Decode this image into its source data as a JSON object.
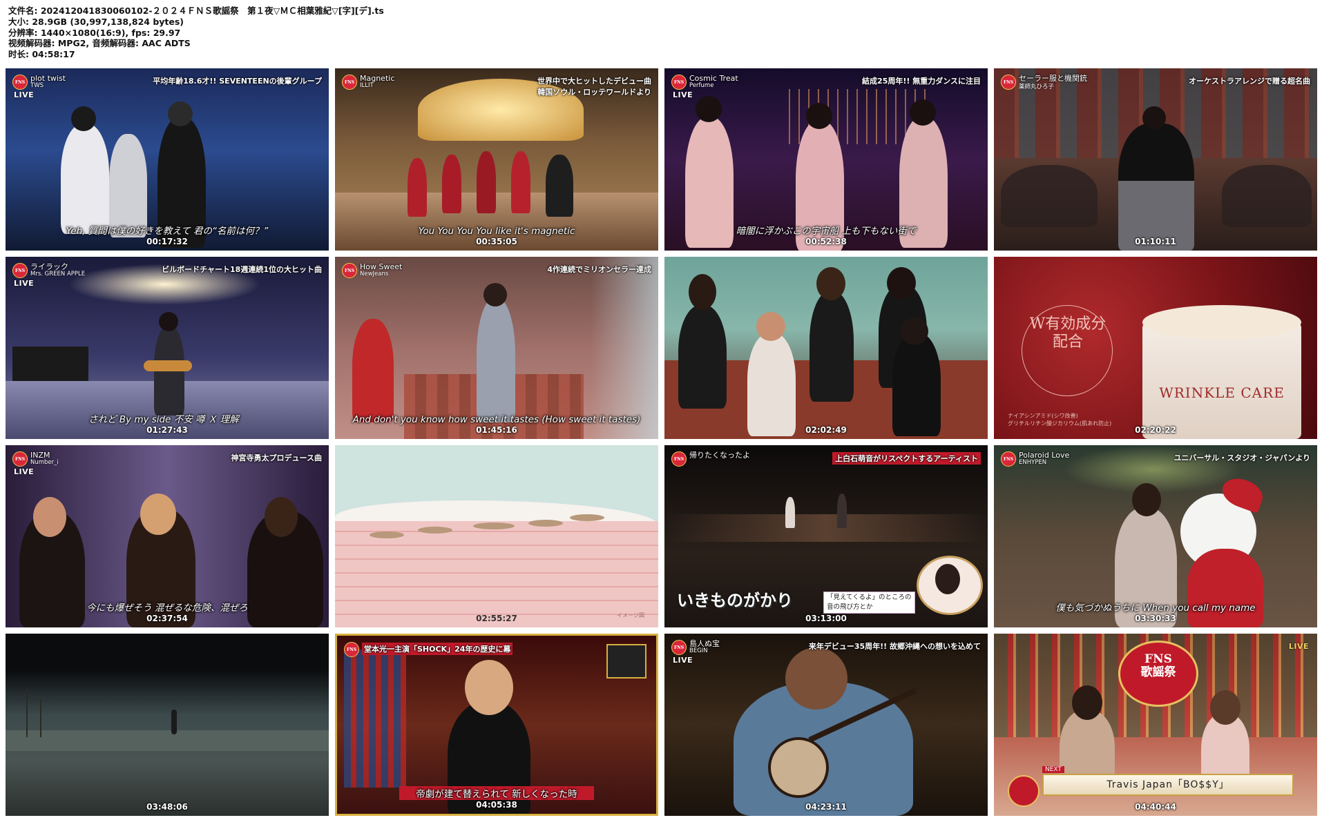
{
  "header": {
    "lines": [
      "文件名: 20241204183006010­2-２０２４ＦＮＳ歌謡祭　第１夜▽ＭＣ相葉雅紀▽[字][デ].ts",
      "大小: 28.9GB (30,997,138,824 bytes)",
      "分辨率: 1440×1080(16:9), fps: 29.97",
      "视频解码器: MPG2, 音频解码器: AAC ADTS",
      "时长: 04:58:17"
    ]
  },
  "tiles": [
    {
      "song": "plot twist",
      "artist": "TWS",
      "live": "LIVE",
      "caption": "平均年齢18.6才!! SEVENTEENの後輩グループ",
      "subtitle": "Yeh, 質問は僕の好きを教えて 君の“名前は何？”",
      "timestamp": "00:17:32",
      "bg": "#2a3f78"
    },
    {
      "song": "Magnetic",
      "artist": "ILLIT",
      "live": "",
      "caption": "世界中で大ヒットしたデビュー曲\n韓国ソウル・ロッテワールドより",
      "subtitle": "You You You You like it's magnetic",
      "timestamp": "00:35:05",
      "bg": "#5a4634"
    },
    {
      "song": "Cosmic Treat",
      "artist": "Perfume",
      "live": "LIVE",
      "caption": "結成25周年!! 無重力ダンスに注目",
      "subtitle": "暗闇に浮かぶこの宇宙船 上も下もない街で",
      "timestamp": "00:52:38",
      "bg": "#2b1a3a"
    },
    {
      "song": "セーラー服と機関銃",
      "artist": "薬師丸ひろ子",
      "live": "",
      "caption": "オーケストラアレンジで贈る超名曲",
      "subtitle": "",
      "timestamp": "01:10:11",
      "bg": "#3a2a26"
    },
    {
      "song": "ライラック",
      "artist": "Mrs. GREEN APPLE",
      "live": "LIVE",
      "caption": "ビルボードチャート18週連続1位の大ヒット曲",
      "subtitle": "されど By my side 不安 噂 Ｘ 理解",
      "timestamp": "01:27:43",
      "bg": "#33305c"
    },
    {
      "song": "How Sweet",
      "artist": "NewJeans",
      "live": "",
      "caption": "4作連続でミリオンセラー達成",
      "subtitle": "And don't you know how sweet it tastes (How sweet it tastes)",
      "timestamp": "01:45:16",
      "bg": "#8a5e52"
    },
    {
      "song": "",
      "artist": "",
      "live": "",
      "caption": "",
      "subtitle": "",
      "timestamp": "02:02:49",
      "bg": "#6fa49a"
    },
    {
      "song": "",
      "artist": "",
      "live": "",
      "caption": "",
      "subtitle": "",
      "timestamp": "02:20:22",
      "bg": "#8e1a1f",
      "ad_text": "W有効成分\n配合",
      "ad_small": "ナイアシンアミド(シワ改善)\nグリチルリチン酸ジカリウム(肌あれ防止)",
      "ad_product": "WRINKLE CARE"
    },
    {
      "song": "INZM",
      "artist": "Number_i",
      "live": "LIVE",
      "caption": "神宮寺勇太プロデュース曲",
      "subtitle": "今にも爆ぜそう 混ぜるな危険、混ぜろ",
      "timestamp": "02:37:54",
      "bg": "#3a2e4a"
    },
    {
      "song": "",
      "artist": "",
      "live": "",
      "caption": "",
      "subtitle": "",
      "timestamp": "02:55:27",
      "bg": "#cfe3df",
      "note": "イメージ図"
    },
    {
      "song": "帰りたくなったよ",
      "artist": "",
      "live": "",
      "caption": "上白石萌音がリスペクトするアーティスト",
      "subtitle": "",
      "timestamp": "03:13:00",
      "bg": "#1a1412",
      "title_big": "いきものがかり",
      "bubble": "「見えてくるよ」のところの\n音の飛び方とか"
    },
    {
      "song": "Polaroid Love",
      "artist": "ENHYPEN",
      "live": "",
      "caption": "ユニバーサル・スタジオ・ジャパンより",
      "subtitle": "僕も気づかぬうちに When you call my name",
      "timestamp": "03:30:33",
      "bg": "#3e2e28"
    },
    {
      "song": "",
      "artist": "",
      "live": "",
      "caption": "",
      "subtitle": "",
      "timestamp": "03:48:06",
      "bg": "#3c4a4c"
    },
    {
      "song": "",
      "artist": "",
      "live": "",
      "caption": "堂本光一主演「SHOCK」24年の歴史に幕",
      "subtitle": "帝劇が建て替えられて 新しくなった時",
      "timestamp": "04:05:38",
      "bg": "#4a1616"
    },
    {
      "song": "島人ぬ宝",
      "artist": "BEGIN",
      "live": "LIVE",
      "caption": "来年デビュー35周年!! 故郷沖縄への想いを込めて",
      "subtitle": "",
      "timestamp": "04:23:11",
      "bg": "#2a2018"
    },
    {
      "song": "",
      "artist": "",
      "live": "LIVE",
      "caption": "",
      "subtitle": "",
      "timestamp": "04:40:44",
      "bg": "#6a2a22",
      "fns_title": "FNS\n歌謡祭",
      "next_label": "NEXT",
      "next_text": "Travis Japan「BO$$Y」"
    }
  ],
  "logo_text": "FNS"
}
